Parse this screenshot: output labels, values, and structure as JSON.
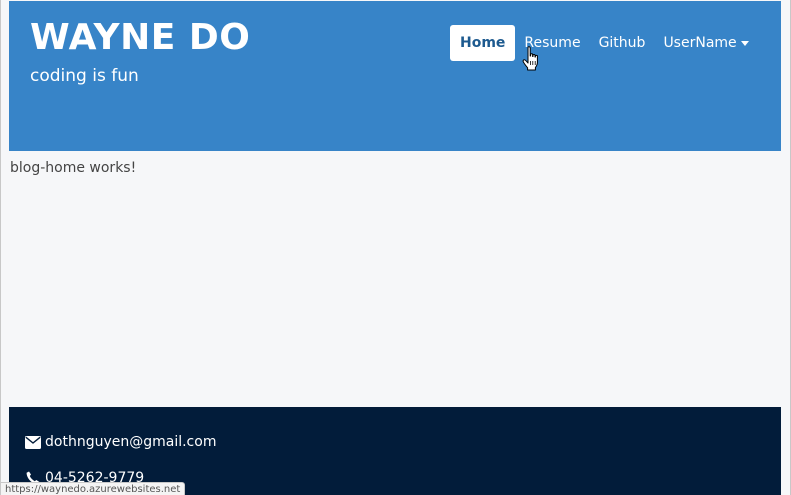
{
  "header": {
    "title": "WAYNE DO",
    "subtitle": "coding is fun"
  },
  "nav": {
    "items": [
      {
        "label": "Home",
        "active": true
      },
      {
        "label": "Resume",
        "active": false
      },
      {
        "label": "Github",
        "active": false
      },
      {
        "label": "UserName",
        "active": false,
        "dropdown": true
      }
    ]
  },
  "main": {
    "text": "blog-home works!"
  },
  "footer": {
    "email": "dothnguyen@gmail.com",
    "email_icon": "envelope-icon",
    "phone": "04-5262-9779",
    "phone_icon": "phone-icon"
  },
  "status_bar": {
    "url": "https://waynedo.azurewebsites.net"
  },
  "colors": {
    "header_bg": "#3784c8",
    "footer_bg": "#021c3a",
    "page_bg": "#f6f7f9",
    "active_nav_text": "#1d5a8f"
  }
}
